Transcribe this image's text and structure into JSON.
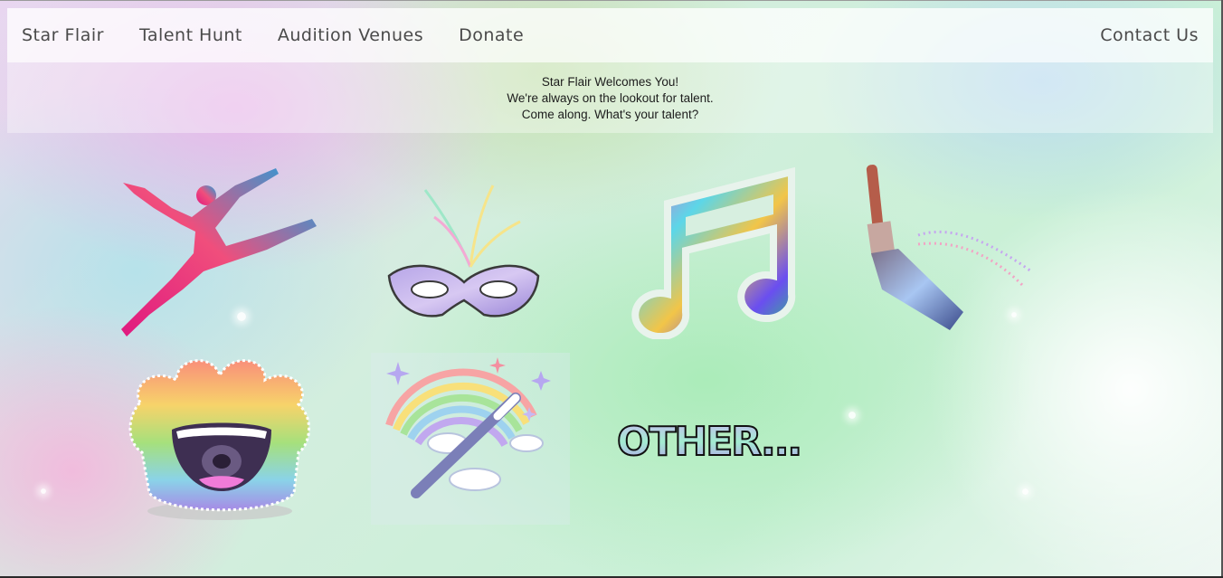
{
  "nav": {
    "brand": "Star Flair",
    "items": [
      "Talent Hunt",
      "Audition Venues",
      "Donate"
    ],
    "contact": "Contact Us"
  },
  "welcome": {
    "line1": "Star Flair Welcomes You!",
    "line2": "We're always on the lookout for talent.",
    "line3": "Come along. What's your talent?"
  },
  "talents": [
    {
      "icon": "dancer-icon"
    },
    {
      "icon": "drama-mask-icon"
    },
    {
      "icon": "music-note-icon"
    },
    {
      "icon": "paintbrush-icon"
    },
    {
      "icon": "laughing-face-icon"
    },
    {
      "icon": "magic-wand-rainbow-icon"
    },
    {
      "icon": "other-text-icon",
      "label": "OTHER..."
    }
  ]
}
